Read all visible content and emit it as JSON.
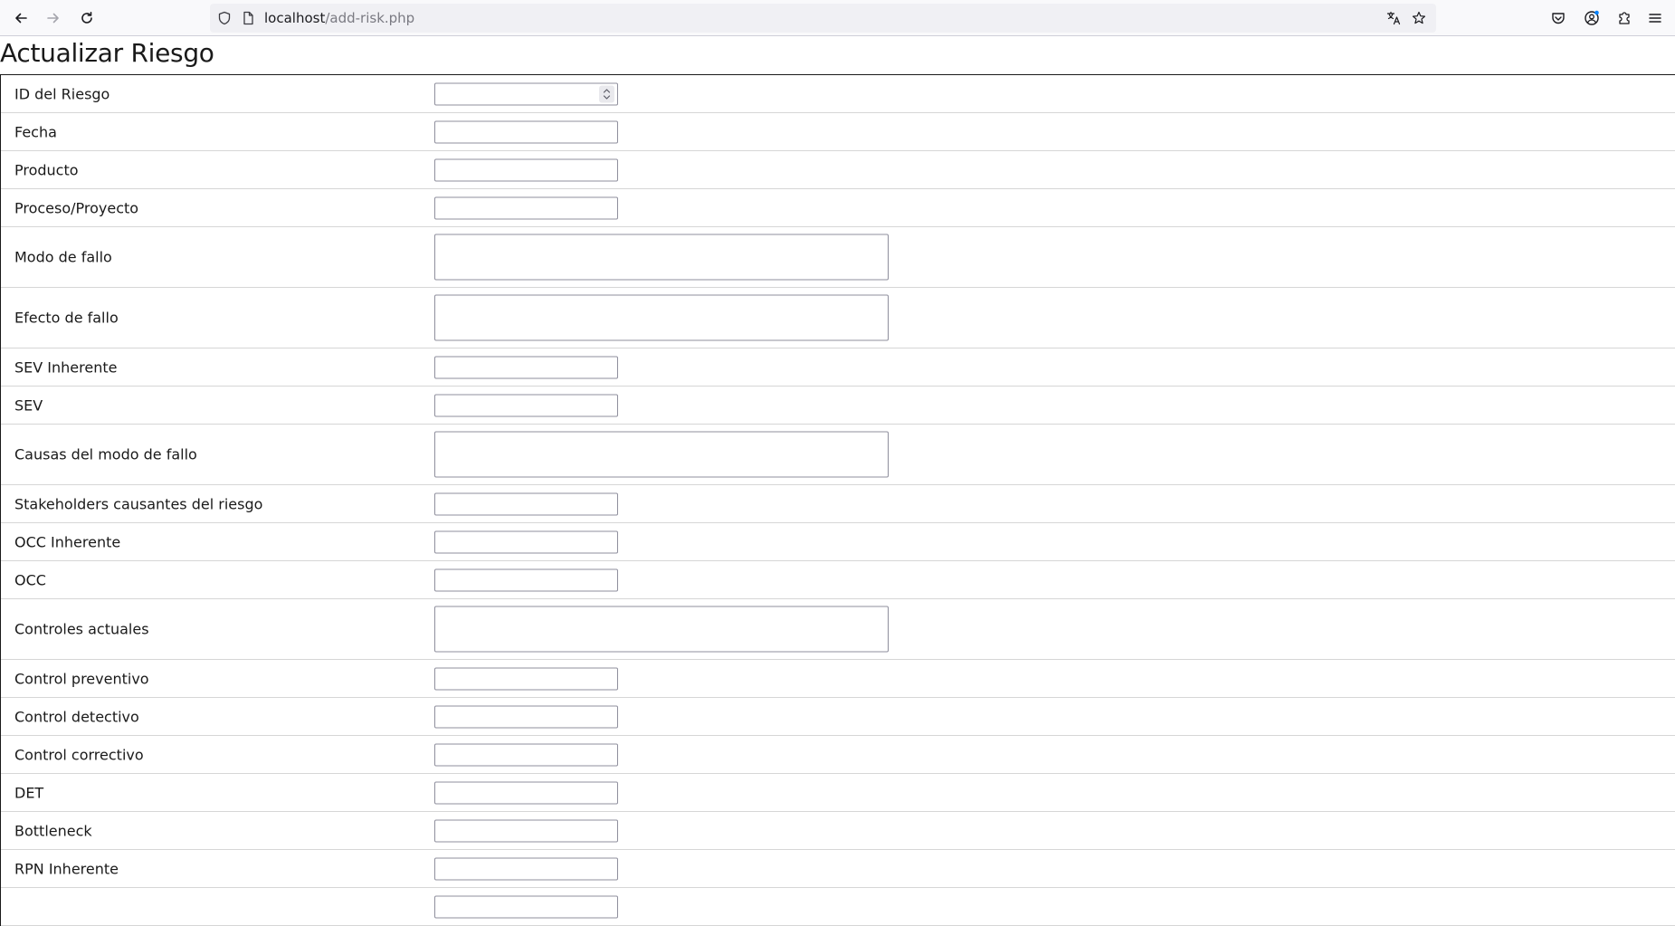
{
  "browser": {
    "url_host": "localhost",
    "url_path": "/add-risk.php"
  },
  "page": {
    "title": "Actualizar Riesgo"
  },
  "form": {
    "fields": [
      {
        "label": "ID del Riesgo",
        "type": "number",
        "value": ""
      },
      {
        "label": "Fecha",
        "type": "text",
        "value": ""
      },
      {
        "label": "Producto",
        "type": "text",
        "value": ""
      },
      {
        "label": "Proceso/Proyecto",
        "type": "text",
        "value": ""
      },
      {
        "label": "Modo de fallo",
        "type": "textarea",
        "value": ""
      },
      {
        "label": "Efecto de fallo",
        "type": "textarea",
        "value": ""
      },
      {
        "label": "SEV Inherente",
        "type": "text",
        "value": ""
      },
      {
        "label": "SEV",
        "type": "text",
        "value": ""
      },
      {
        "label": "Causas del modo de fallo",
        "type": "textarea",
        "value": ""
      },
      {
        "label": "Stakeholders causantes del riesgo",
        "type": "text",
        "value": ""
      },
      {
        "label": "OCC Inherente",
        "type": "text",
        "value": ""
      },
      {
        "label": "OCC",
        "type": "text",
        "value": ""
      },
      {
        "label": "Controles actuales",
        "type": "textarea",
        "value": ""
      },
      {
        "label": "Control preventivo",
        "type": "text",
        "value": ""
      },
      {
        "label": "Control detectivo",
        "type": "text",
        "value": ""
      },
      {
        "label": "Control correctivo",
        "type": "text",
        "value": ""
      },
      {
        "label": "DET",
        "type": "text",
        "value": ""
      },
      {
        "label": "Bottleneck",
        "type": "text",
        "value": ""
      },
      {
        "label": "RPN Inherente",
        "type": "text",
        "value": ""
      },
      {
        "label": "",
        "type": "text",
        "value": ""
      }
    ]
  },
  "icons": {
    "back": "arrow-left-icon",
    "forward": "arrow-right-icon",
    "reload": "reload-icon",
    "tracking_protection": "shield-icon",
    "page_info": "page-icon",
    "translate": "translate-icon",
    "bookmark": "star-icon",
    "pocket": "pocket-icon",
    "account": "account-icon",
    "extensions": "puzzle-icon",
    "menu": "hamburger-menu-icon"
  },
  "colors": {
    "toolbar_bg": "#f9f9fb",
    "urlbar_bg": "#f0f0f4",
    "account_badge": "#0a84ff"
  }
}
